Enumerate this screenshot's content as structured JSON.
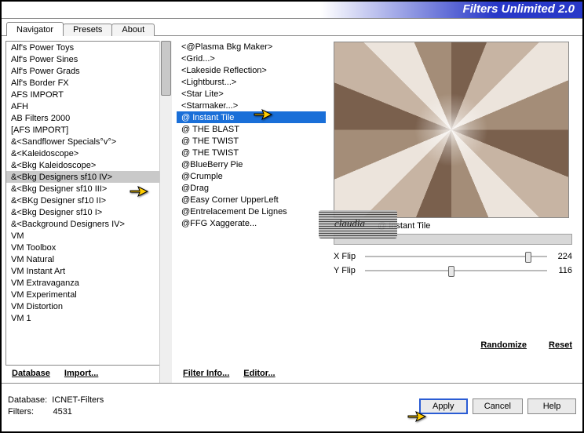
{
  "app": {
    "title": "Filters Unlimited 2.0"
  },
  "tabs": [
    "Navigator",
    "Presets",
    "About"
  ],
  "categories": {
    "items": [
      "VM 1",
      "VM Distortion",
      "VM Experimental",
      "VM Extravaganza",
      "VM Instant Art",
      "VM Natural",
      "VM Toolbox",
      "VM",
      "&<Background Designers IV>",
      "&<Bkg Designer sf10 I>",
      "&<BKg Designer sf10 II>",
      "&<Bkg Designer sf10 III>",
      "&<Bkg Designers sf10 IV>",
      "&<Bkg Kaleidoscope>",
      "&<Kaleidoscope>",
      "&<Sandflower Specials°v°>",
      "[AFS IMPORT]",
      "AB Filters 2000",
      "AFH",
      "AFS IMPORT",
      "Alf's Border FX",
      "Alf's Power Grads",
      "Alf's Power Sines",
      "Alf's Power Toys"
    ],
    "selected_index": 12
  },
  "filters": {
    "items": [
      "<@Plasma Bkg Maker>",
      "<Grid...>",
      "<Lakeside Reflection>",
      "<Lightburst...>",
      "<Star Lite>",
      "<Starmaker...>",
      "@ Instant Tile",
      "@ THE BLAST",
      "@ THE TWIST",
      "@ THE TWIST",
      "@BlueBerry Pie",
      "@Crumple",
      "@Drag",
      "@Easy Corner UpperLeft",
      "@Entrelacement De Lignes",
      "@FFG Xaggerate..."
    ],
    "selected_index": 6
  },
  "preview": {
    "filter_name": "@ Instant Tile"
  },
  "sliders": [
    {
      "label": "X Flip",
      "value": 224,
      "max": 255
    },
    {
      "label": "Y Flip",
      "value": 116,
      "max": 255
    }
  ],
  "links": {
    "database": "Database",
    "import": "Import...",
    "filterinfo": "Filter Info...",
    "editor": "Editor...",
    "randomize": "Randomize",
    "reset": "Reset"
  },
  "footer": {
    "db_label": "Database:",
    "db_value": "ICNET-Filters",
    "flt_label": "Filters:",
    "flt_value": "4531",
    "apply": "Apply",
    "cancel": "Cancel",
    "help": "Help"
  },
  "watermark": "claudia"
}
